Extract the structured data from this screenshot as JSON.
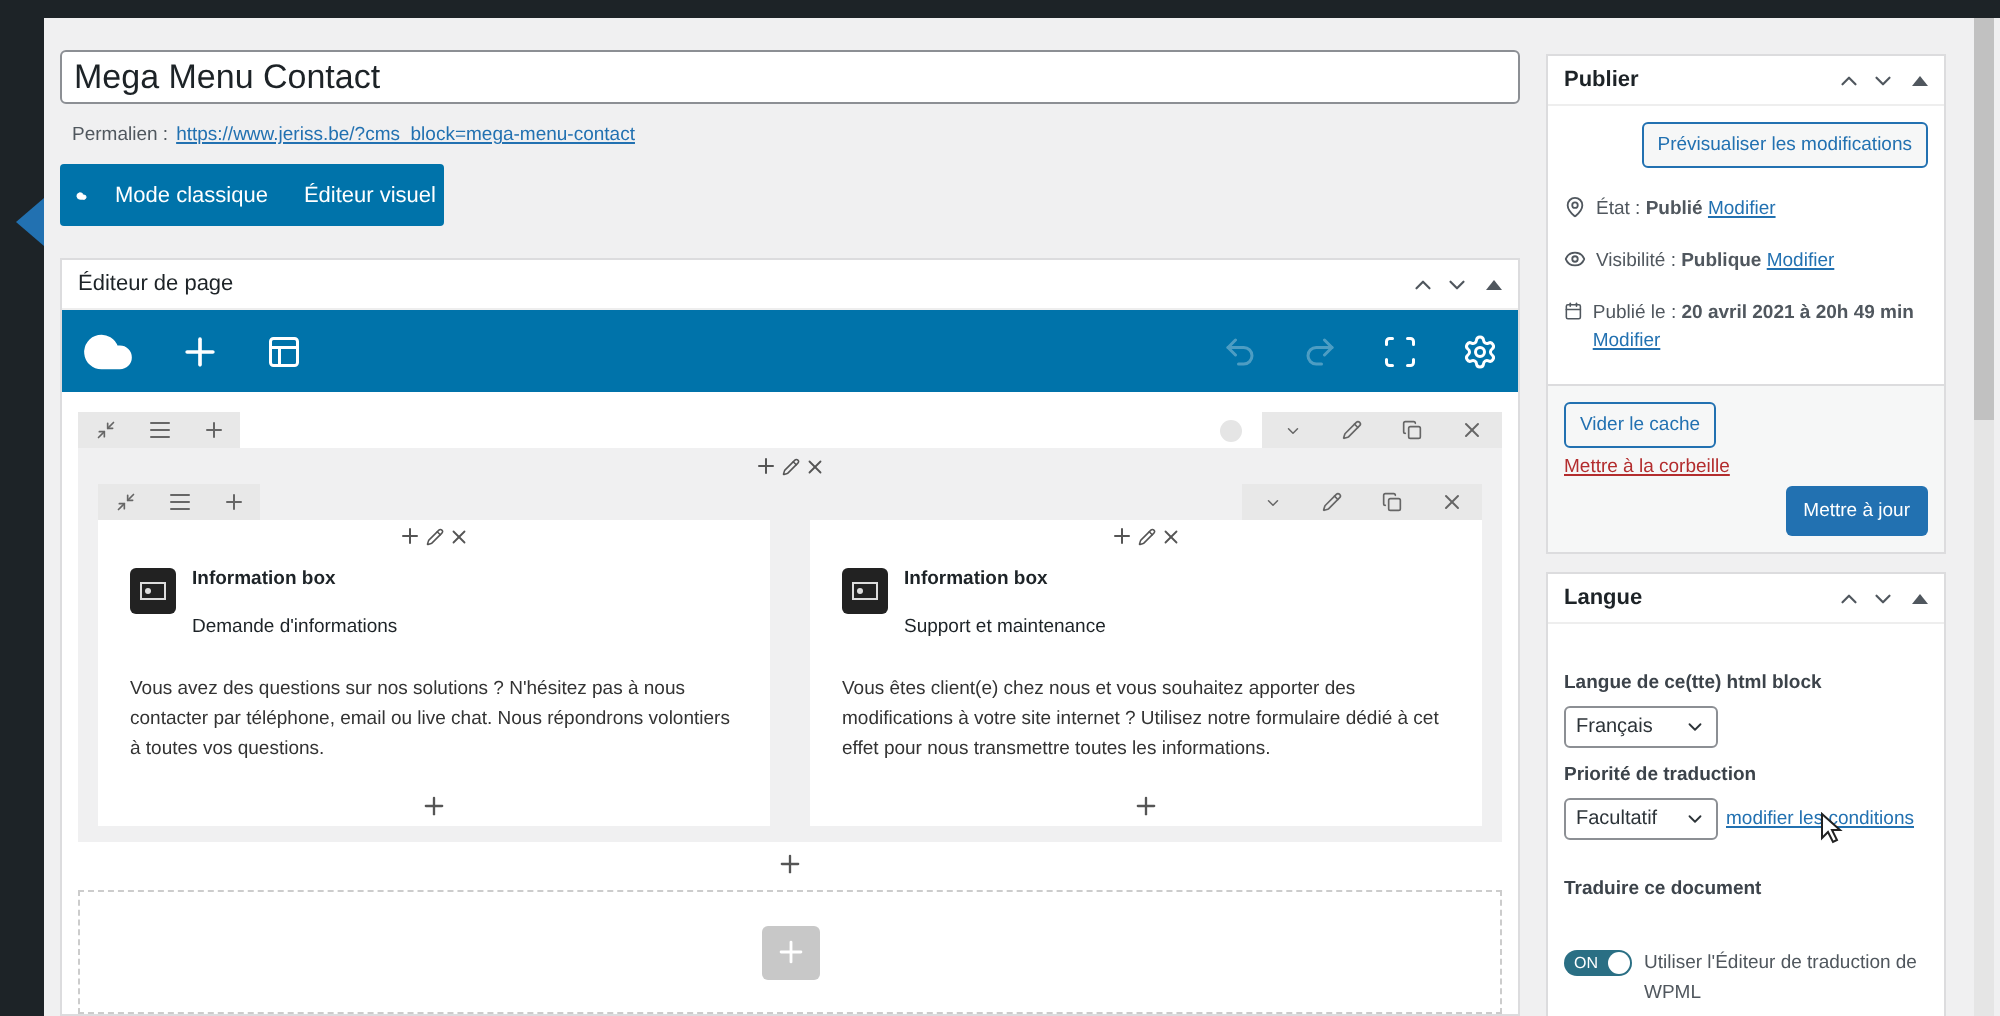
{
  "title": "Mega Menu Contact",
  "permalink": {
    "label": "Permalien :",
    "url": "https://www.jeriss.be/?cms_block=mega-menu-contact"
  },
  "mode_buttons": [
    "Mode classique",
    "Éditeur visuel"
  ],
  "page_editor": {
    "title": "Éditeur de page",
    "undo_disabled": true,
    "redo_disabled": true,
    "columns": [
      {
        "widget": "Information box",
        "subtitle": "Demande d'informations",
        "body": "Vous avez des questions sur nos solutions ? N'hésitez pas à nous contacter par téléphone, email ou live chat. Nous répondrons volontiers à toutes vos questions."
      },
      {
        "widget": "Information box",
        "subtitle": "Support et maintenance",
        "body": "Vous êtes client(e) chez nous et vous souhaitez apporter des modifications à votre site internet ? Utilisez notre formulaire dédié à cet effet pour nous transmettre toutes les informations."
      }
    ]
  },
  "publish": {
    "title": "Publier",
    "preview": "Prévisualiser les modifications",
    "meta": [
      {
        "kind": "status",
        "label": "État :",
        "value": "Publié",
        "link": "Modifier"
      },
      {
        "kind": "visibility",
        "label": "Visibilité :",
        "value": "Publique",
        "link": "Modifier"
      },
      {
        "kind": "date",
        "label": "Publié le :",
        "value": "20 avril 2021 à 20h 49 min",
        "link": "Modifier"
      }
    ],
    "clear_cache": "Vider le cache",
    "trash": "Mettre à la corbeille",
    "update": "Mettre à jour"
  },
  "language": {
    "title": "Langue",
    "language_label": "Langue de ce(tte) html block",
    "language": "Français",
    "priority_label": "Priorité de traduction",
    "priority": "Facultatif",
    "conditions_link": "modifier les conditions",
    "translate_label": "Traduire ce document",
    "toggle_on": true,
    "toggle_label": "ON",
    "toggle_text": "Utiliser l'Éditeur de traduction de WPML"
  }
}
